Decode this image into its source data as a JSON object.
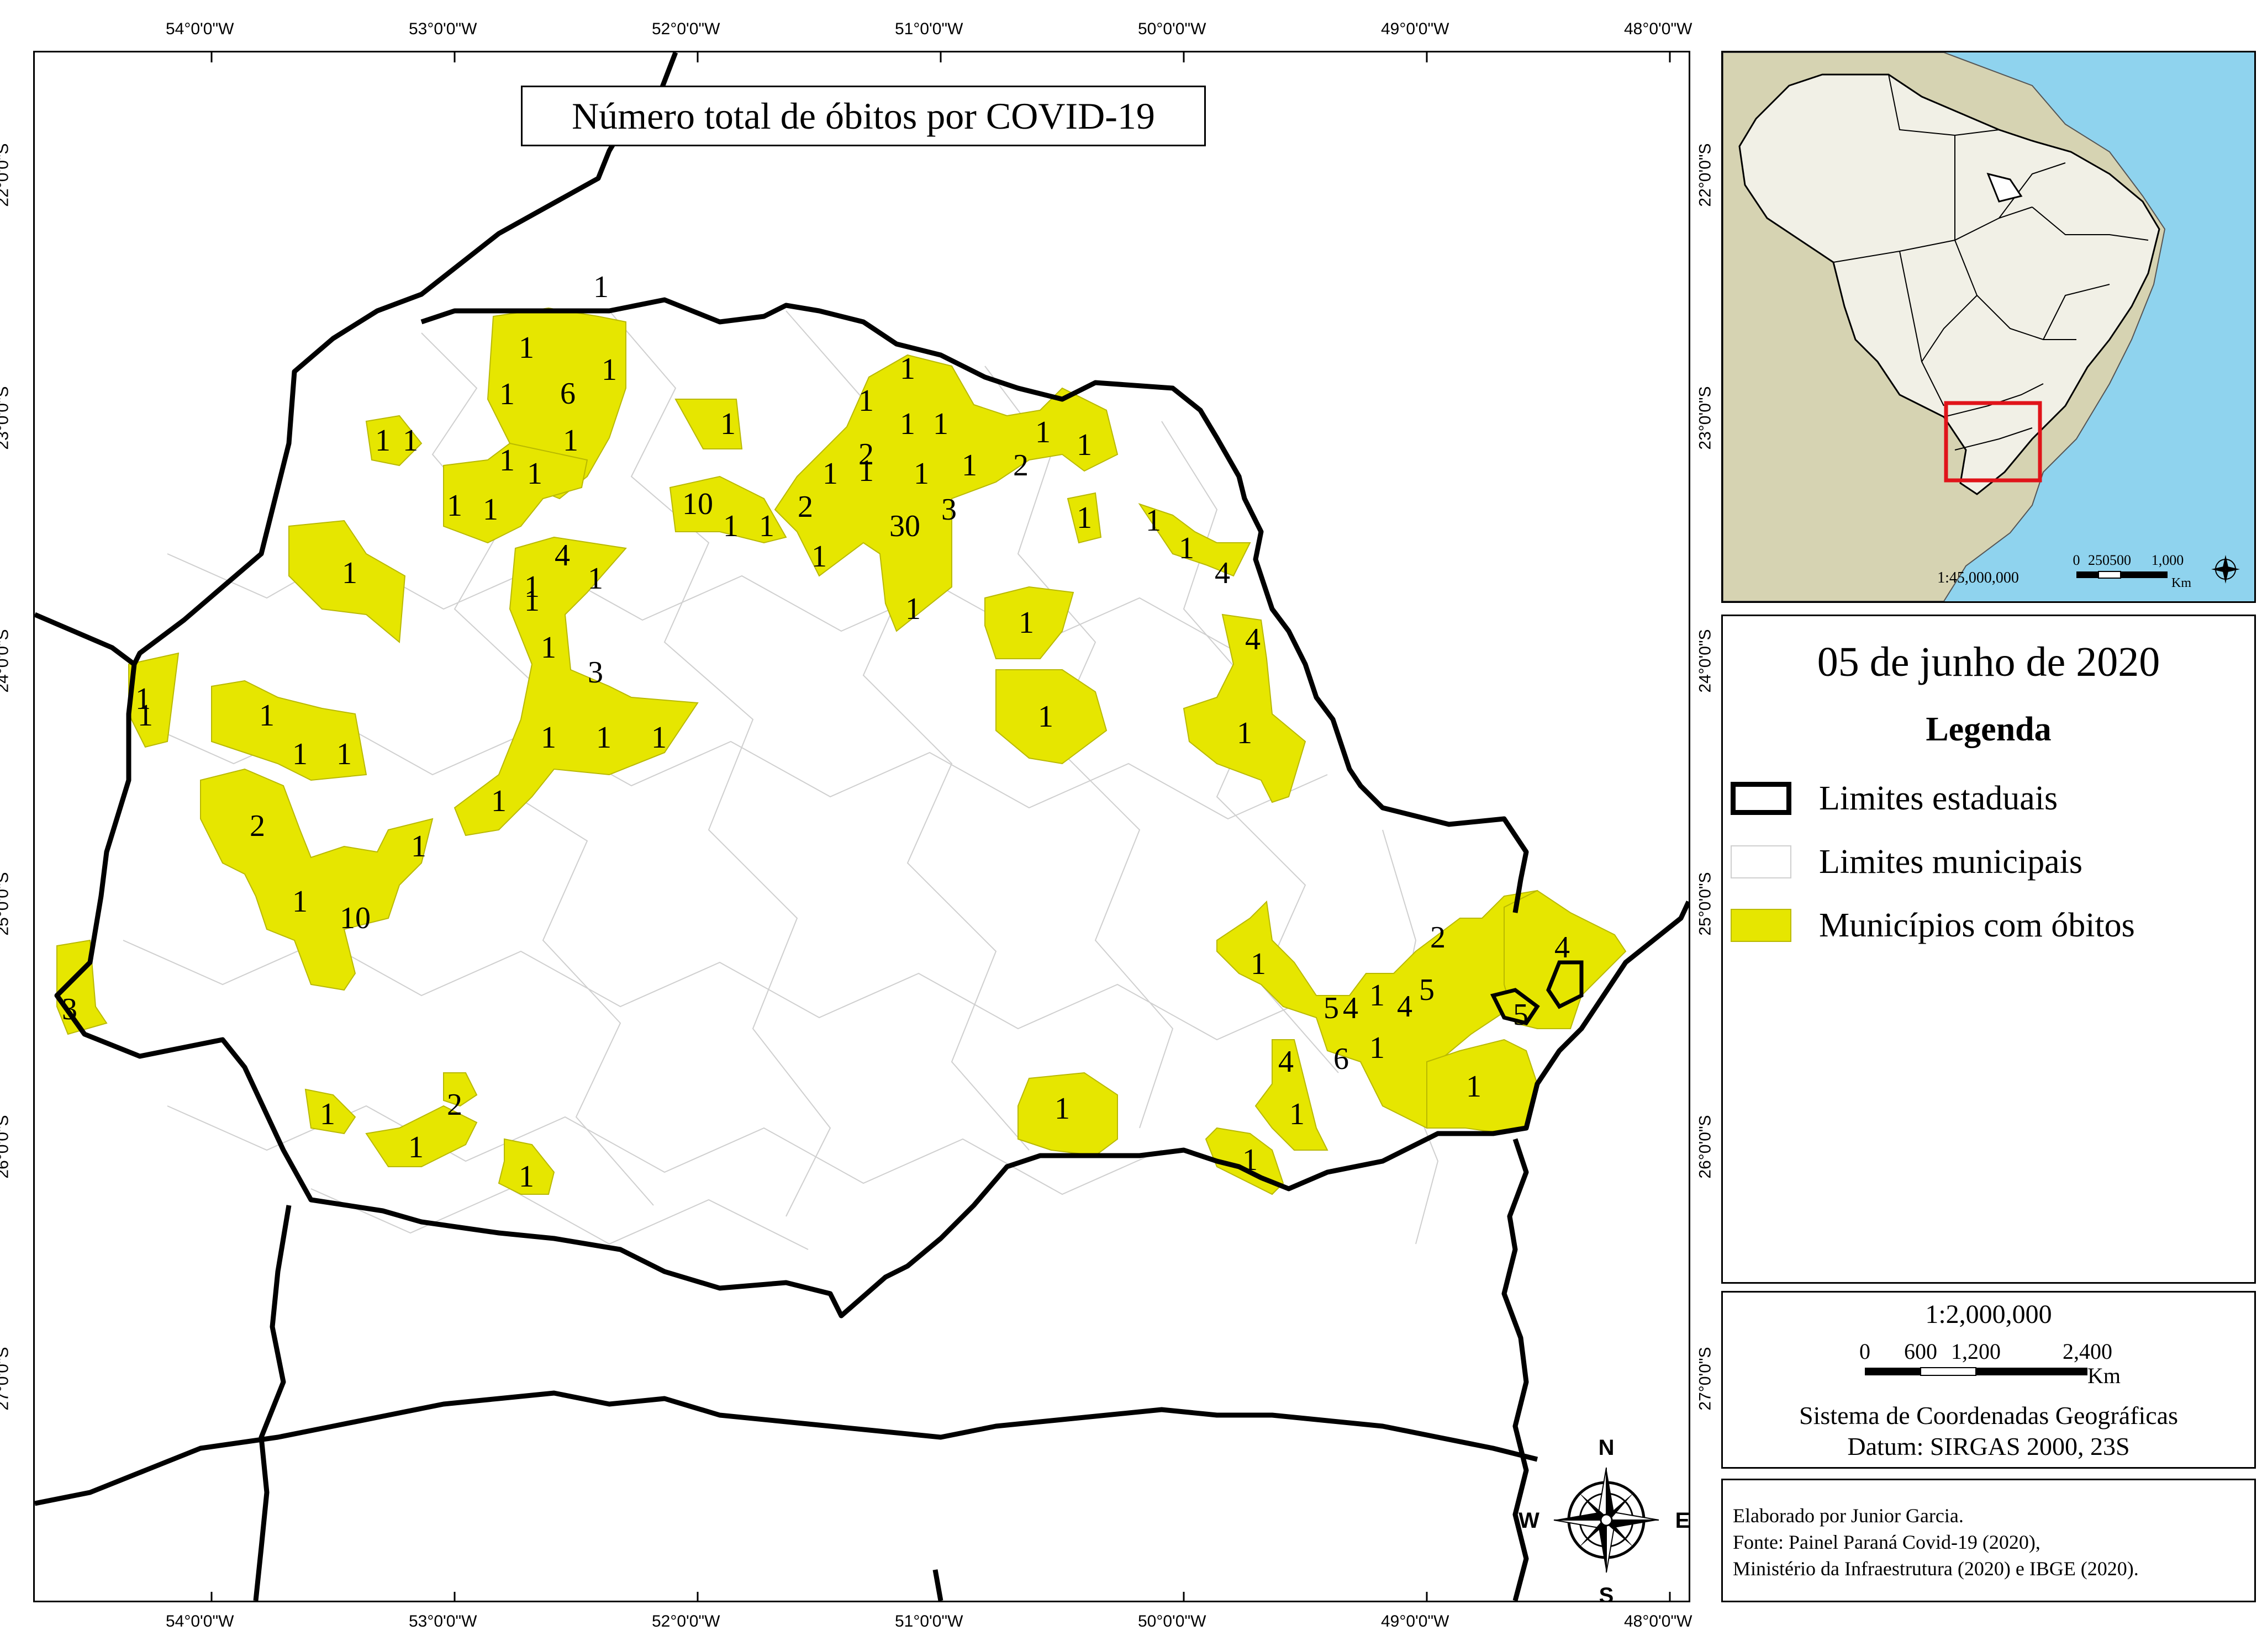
{
  "map": {
    "title": "Número total de óbitos por COVID-19",
    "lon_labels": [
      "54°0'0\"W",
      "53°0'0\"W",
      "52°0'0\"W",
      "51°0'0\"W",
      "50°0'0\"W",
      "49°0'0\"W",
      "48°0'0\"W"
    ],
    "lat_labels": [
      "22°0'0\"S",
      "23°0'0\"S",
      "24°0'0\"S",
      "25°0'0\"S",
      "26°0'0\"S",
      "27°0'0\"S"
    ],
    "death_counts": [
      "1",
      "1",
      "6",
      "1",
      "1",
      "1",
      "1",
      "1",
      "1",
      "1",
      "1",
      "1",
      "1",
      "1",
      "1",
      "1",
      "1",
      "1",
      "2",
      "1",
      "1",
      "1",
      "2",
      "1",
      "1",
      "10",
      "1",
      "1",
      "2",
      "30",
      "1",
      "3",
      "1",
      "1",
      "1",
      "1",
      "4",
      "1",
      "1",
      "4",
      "1",
      "1",
      "1",
      "3",
      "1",
      "1",
      "1",
      "1",
      "1",
      "1",
      "1",
      "1",
      "4",
      "1",
      "1",
      "1",
      "2",
      "1",
      "1",
      "10",
      "1",
      "2",
      "1",
      "4",
      "5",
      "5",
      "4",
      "6",
      "1",
      "4",
      "1",
      "5",
      "4",
      "1",
      "1",
      "1",
      "3",
      "1",
      "1",
      "2",
      "1",
      "1",
      "1"
    ],
    "compass": {
      "n": "N",
      "s": "S",
      "e": "E",
      "w": "W"
    }
  },
  "inset": {
    "scale_ratio": "1:45,000,000",
    "scale_ticks": [
      "0",
      "250500",
      "1,000"
    ],
    "scale_unit": "Km"
  },
  "legend": {
    "date": "05 de junho de 2020",
    "title": "Legenda",
    "items": [
      {
        "label": "Limites estaduais"
      },
      {
        "label": "Limites municipais"
      },
      {
        "label": "Municípios com óbitos"
      }
    ]
  },
  "scale": {
    "ratio": "1:2,000,000",
    "ticks": [
      "0",
      "600",
      "1,200",
      "2,400"
    ],
    "unit": "Km",
    "system": "Sistema de Coordenadas Geográficas",
    "datum": "Datum: SIRGAS 2000, 23S"
  },
  "credits": {
    "line1": "Elaborado por Junior Garcia.",
    "line2": "Fonte: Painel Paraná Covid-19 (2020),",
    "line3": "Ministério da Infraestrutura (2020) e IBGE (2020)."
  },
  "colors": {
    "highlight": "#e6e600",
    "ocean": "#8fd3ee",
    "land_other": "#d6d3b2",
    "brazil": "#f1f0e6",
    "frame_red": "#e0141a"
  }
}
